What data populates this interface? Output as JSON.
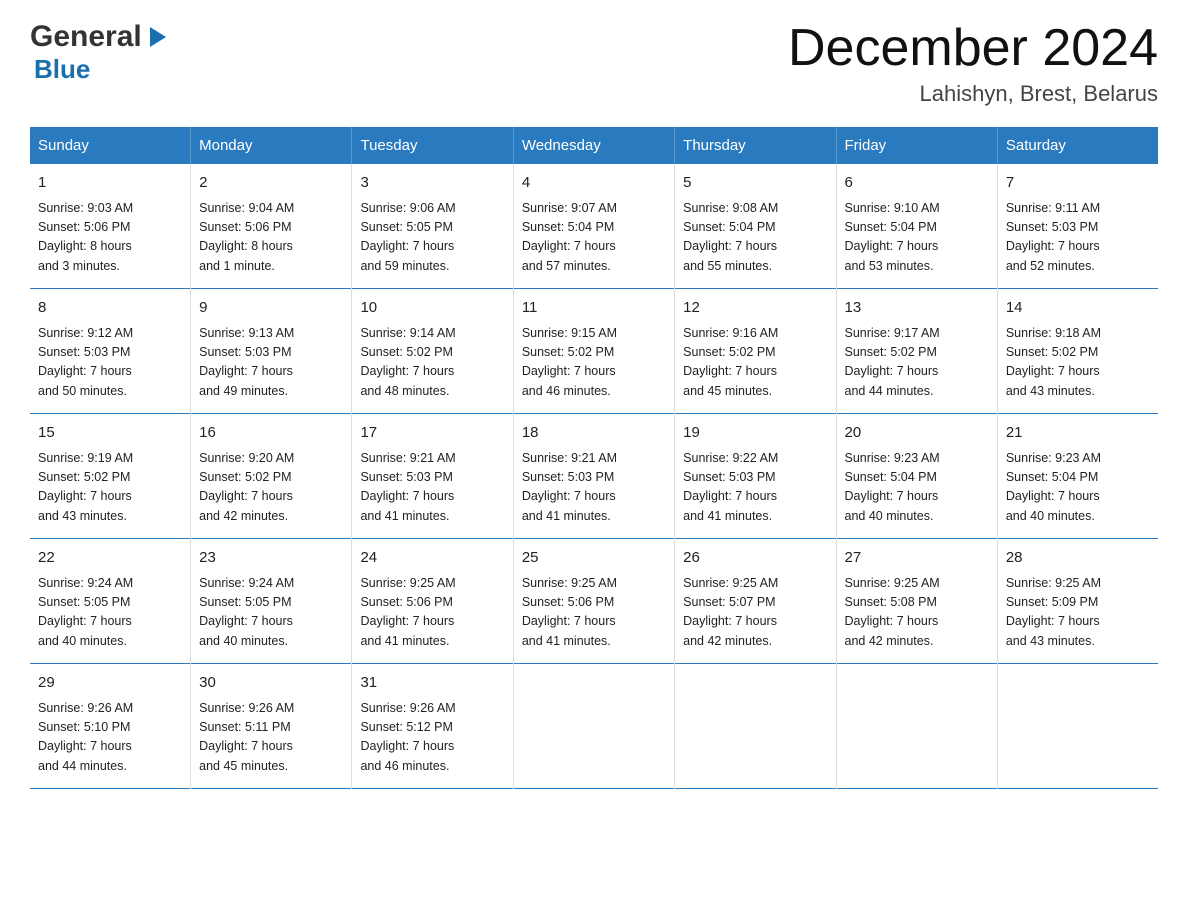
{
  "logo": {
    "general": "General",
    "arrow": "▶",
    "blue": "Blue"
  },
  "title": "December 2024",
  "subtitle": "Lahishyn, Brest, Belarus",
  "header_days": [
    "Sunday",
    "Monday",
    "Tuesday",
    "Wednesday",
    "Thursday",
    "Friday",
    "Saturday"
  ],
  "weeks": [
    [
      {
        "day": "1",
        "info": "Sunrise: 9:03 AM\nSunset: 5:06 PM\nDaylight: 8 hours\nand 3 minutes."
      },
      {
        "day": "2",
        "info": "Sunrise: 9:04 AM\nSunset: 5:06 PM\nDaylight: 8 hours\nand 1 minute."
      },
      {
        "day": "3",
        "info": "Sunrise: 9:06 AM\nSunset: 5:05 PM\nDaylight: 7 hours\nand 59 minutes."
      },
      {
        "day": "4",
        "info": "Sunrise: 9:07 AM\nSunset: 5:04 PM\nDaylight: 7 hours\nand 57 minutes."
      },
      {
        "day": "5",
        "info": "Sunrise: 9:08 AM\nSunset: 5:04 PM\nDaylight: 7 hours\nand 55 minutes."
      },
      {
        "day": "6",
        "info": "Sunrise: 9:10 AM\nSunset: 5:04 PM\nDaylight: 7 hours\nand 53 minutes."
      },
      {
        "day": "7",
        "info": "Sunrise: 9:11 AM\nSunset: 5:03 PM\nDaylight: 7 hours\nand 52 minutes."
      }
    ],
    [
      {
        "day": "8",
        "info": "Sunrise: 9:12 AM\nSunset: 5:03 PM\nDaylight: 7 hours\nand 50 minutes."
      },
      {
        "day": "9",
        "info": "Sunrise: 9:13 AM\nSunset: 5:03 PM\nDaylight: 7 hours\nand 49 minutes."
      },
      {
        "day": "10",
        "info": "Sunrise: 9:14 AM\nSunset: 5:02 PM\nDaylight: 7 hours\nand 48 minutes."
      },
      {
        "day": "11",
        "info": "Sunrise: 9:15 AM\nSunset: 5:02 PM\nDaylight: 7 hours\nand 46 minutes."
      },
      {
        "day": "12",
        "info": "Sunrise: 9:16 AM\nSunset: 5:02 PM\nDaylight: 7 hours\nand 45 minutes."
      },
      {
        "day": "13",
        "info": "Sunrise: 9:17 AM\nSunset: 5:02 PM\nDaylight: 7 hours\nand 44 minutes."
      },
      {
        "day": "14",
        "info": "Sunrise: 9:18 AM\nSunset: 5:02 PM\nDaylight: 7 hours\nand 43 minutes."
      }
    ],
    [
      {
        "day": "15",
        "info": "Sunrise: 9:19 AM\nSunset: 5:02 PM\nDaylight: 7 hours\nand 43 minutes."
      },
      {
        "day": "16",
        "info": "Sunrise: 9:20 AM\nSunset: 5:02 PM\nDaylight: 7 hours\nand 42 minutes."
      },
      {
        "day": "17",
        "info": "Sunrise: 9:21 AM\nSunset: 5:03 PM\nDaylight: 7 hours\nand 41 minutes."
      },
      {
        "day": "18",
        "info": "Sunrise: 9:21 AM\nSunset: 5:03 PM\nDaylight: 7 hours\nand 41 minutes."
      },
      {
        "day": "19",
        "info": "Sunrise: 9:22 AM\nSunset: 5:03 PM\nDaylight: 7 hours\nand 41 minutes."
      },
      {
        "day": "20",
        "info": "Sunrise: 9:23 AM\nSunset: 5:04 PM\nDaylight: 7 hours\nand 40 minutes."
      },
      {
        "day": "21",
        "info": "Sunrise: 9:23 AM\nSunset: 5:04 PM\nDaylight: 7 hours\nand 40 minutes."
      }
    ],
    [
      {
        "day": "22",
        "info": "Sunrise: 9:24 AM\nSunset: 5:05 PM\nDaylight: 7 hours\nand 40 minutes."
      },
      {
        "day": "23",
        "info": "Sunrise: 9:24 AM\nSunset: 5:05 PM\nDaylight: 7 hours\nand 40 minutes."
      },
      {
        "day": "24",
        "info": "Sunrise: 9:25 AM\nSunset: 5:06 PM\nDaylight: 7 hours\nand 41 minutes."
      },
      {
        "day": "25",
        "info": "Sunrise: 9:25 AM\nSunset: 5:06 PM\nDaylight: 7 hours\nand 41 minutes."
      },
      {
        "day": "26",
        "info": "Sunrise: 9:25 AM\nSunset: 5:07 PM\nDaylight: 7 hours\nand 42 minutes."
      },
      {
        "day": "27",
        "info": "Sunrise: 9:25 AM\nSunset: 5:08 PM\nDaylight: 7 hours\nand 42 minutes."
      },
      {
        "day": "28",
        "info": "Sunrise: 9:25 AM\nSunset: 5:09 PM\nDaylight: 7 hours\nand 43 minutes."
      }
    ],
    [
      {
        "day": "29",
        "info": "Sunrise: 9:26 AM\nSunset: 5:10 PM\nDaylight: 7 hours\nand 44 minutes."
      },
      {
        "day": "30",
        "info": "Sunrise: 9:26 AM\nSunset: 5:11 PM\nDaylight: 7 hours\nand 45 minutes."
      },
      {
        "day": "31",
        "info": "Sunrise: 9:26 AM\nSunset: 5:12 PM\nDaylight: 7 hours\nand 46 minutes."
      },
      {
        "day": "",
        "info": ""
      },
      {
        "day": "",
        "info": ""
      },
      {
        "day": "",
        "info": ""
      },
      {
        "day": "",
        "info": ""
      }
    ]
  ]
}
